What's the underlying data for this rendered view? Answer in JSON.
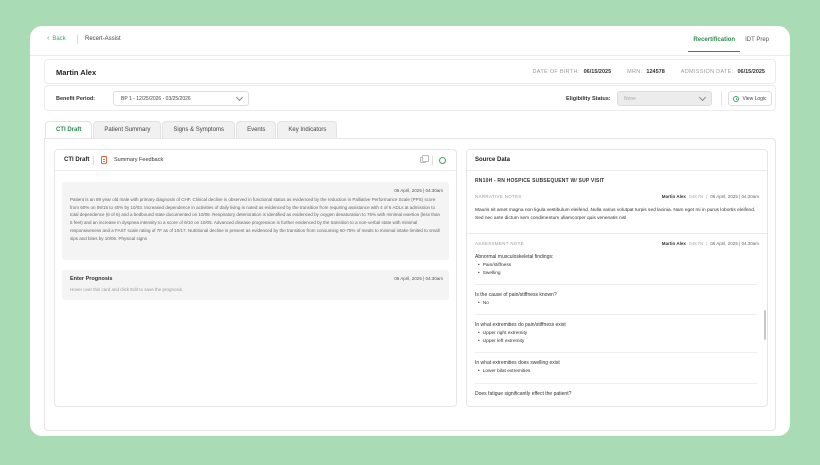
{
  "topbar": {
    "back_label": "Back",
    "app_name": "Recert-Assist",
    "tabs": [
      {
        "label": "Recertification",
        "active": true
      },
      {
        "label": "IDT Prep",
        "active": false
      }
    ]
  },
  "patient": {
    "name": "Martin Alex",
    "dob_label": "DATE OF BIRTH:",
    "dob": "06/15/2025",
    "mrn_label": "MRN:",
    "mrn": "124578",
    "admission_label": "ADMISSION DATE:",
    "admission": "06/15/2025"
  },
  "benefit": {
    "label": "Benefit Period:",
    "selected": "BP 1 - 12/25/2026 - 03/25/2026",
    "eligibility_label": "Eligibility Status:",
    "eligibility_value": "None",
    "view_logic_label": "View Logic"
  },
  "tabs": [
    {
      "label": "CTI Draft",
      "active": true
    },
    {
      "label": "Patient Summary",
      "active": false
    },
    {
      "label": "Signs & Symptoms",
      "active": false
    },
    {
      "label": "Events",
      "active": false
    },
    {
      "label": "Key Indicators",
      "active": false
    }
  ],
  "left": {
    "title": "CTI Draft",
    "summary_feedback": "Summary Feedback",
    "card1": {
      "timestamp": "06 April, 2025 | 04:30am",
      "text": "Patient is an 89 year old male with primary diagnosis of CHF. Clinical decline is observed in functional status as evidenced by the reduction in Palliative Performance Scale (PPS) score from 60% on 09/15 to 40% by 10/03. Increased dependence in activities of daily living is noted as evidenced by the transition from requiring assistance with 4 of 6 ADLs at admission to total dependence (6 of 6) and a bedbound state documented on 10/08. Respiratory deterioration is identified as evidenced by oxygen desaturation to 76% with minimal exertion (less than 5 feet) and an increase in dyspnea intensity to a score of 9/10 on 10/05. Advanced disease progression is further evidenced by the transition to a non-verbal state with minimal responsiveness and a FAST scale rating of 7F as of 10/17. Nutritional decline is present as evidenced by the transition from consuming 60-75% of meals to minimal intake limited to small sips and bites by 10/06. Physical signs"
    },
    "card2": {
      "title": "Enter Prognosis",
      "timestamp": "06 April, 2025 | 04:30am",
      "hint": "Hover over this card and click Edit to save the prognosis."
    }
  },
  "right": {
    "title": "Source Data",
    "visit_title": "RN10H - RN HOSPICE SUBSEQUENT W/ SUP VISIT",
    "narrative": {
      "label": "NARRATIVE NOTES",
      "author": "Martin Alex",
      "code": "S4K7N",
      "date": "06 April, 2025 | 04:20am",
      "text": "Mauris sit amet magna non ligula vestibulum eleifend. Nulla varius volutpat turpis sed lacinia. Nam eget mi in purus lobortis eleifend. Sed nec ante dictum sem condimentum ullamcorper quis venenatis nisl"
    },
    "assessment": {
      "label": "ASSESSMENT NOTE",
      "author": "Martin Alex",
      "code": "S4K7N",
      "date": "06 April, 2025 | 04:30am",
      "q1": "Abnormal musculoskeletal findings:",
      "q1_a1": "Pain/stiffness",
      "q1_a2": "Swelling",
      "q2": "Is the cause of pain/stiffness known?",
      "q2_a1": "No",
      "q3": "In what extremities do pain/stiffness exist",
      "q3_a1": "Upper right extremity",
      "q3_a2": "Upper left extremity",
      "q4": "In what extremities does swelling exist",
      "q4_a1": "Lower bilat extremities",
      "q5": "Does fatigue significantly effect the patient?"
    }
  },
  "colors": {
    "accent": "#2e8b4e",
    "background": "#a9dcb4",
    "icon_orange": "#e46d3a"
  }
}
